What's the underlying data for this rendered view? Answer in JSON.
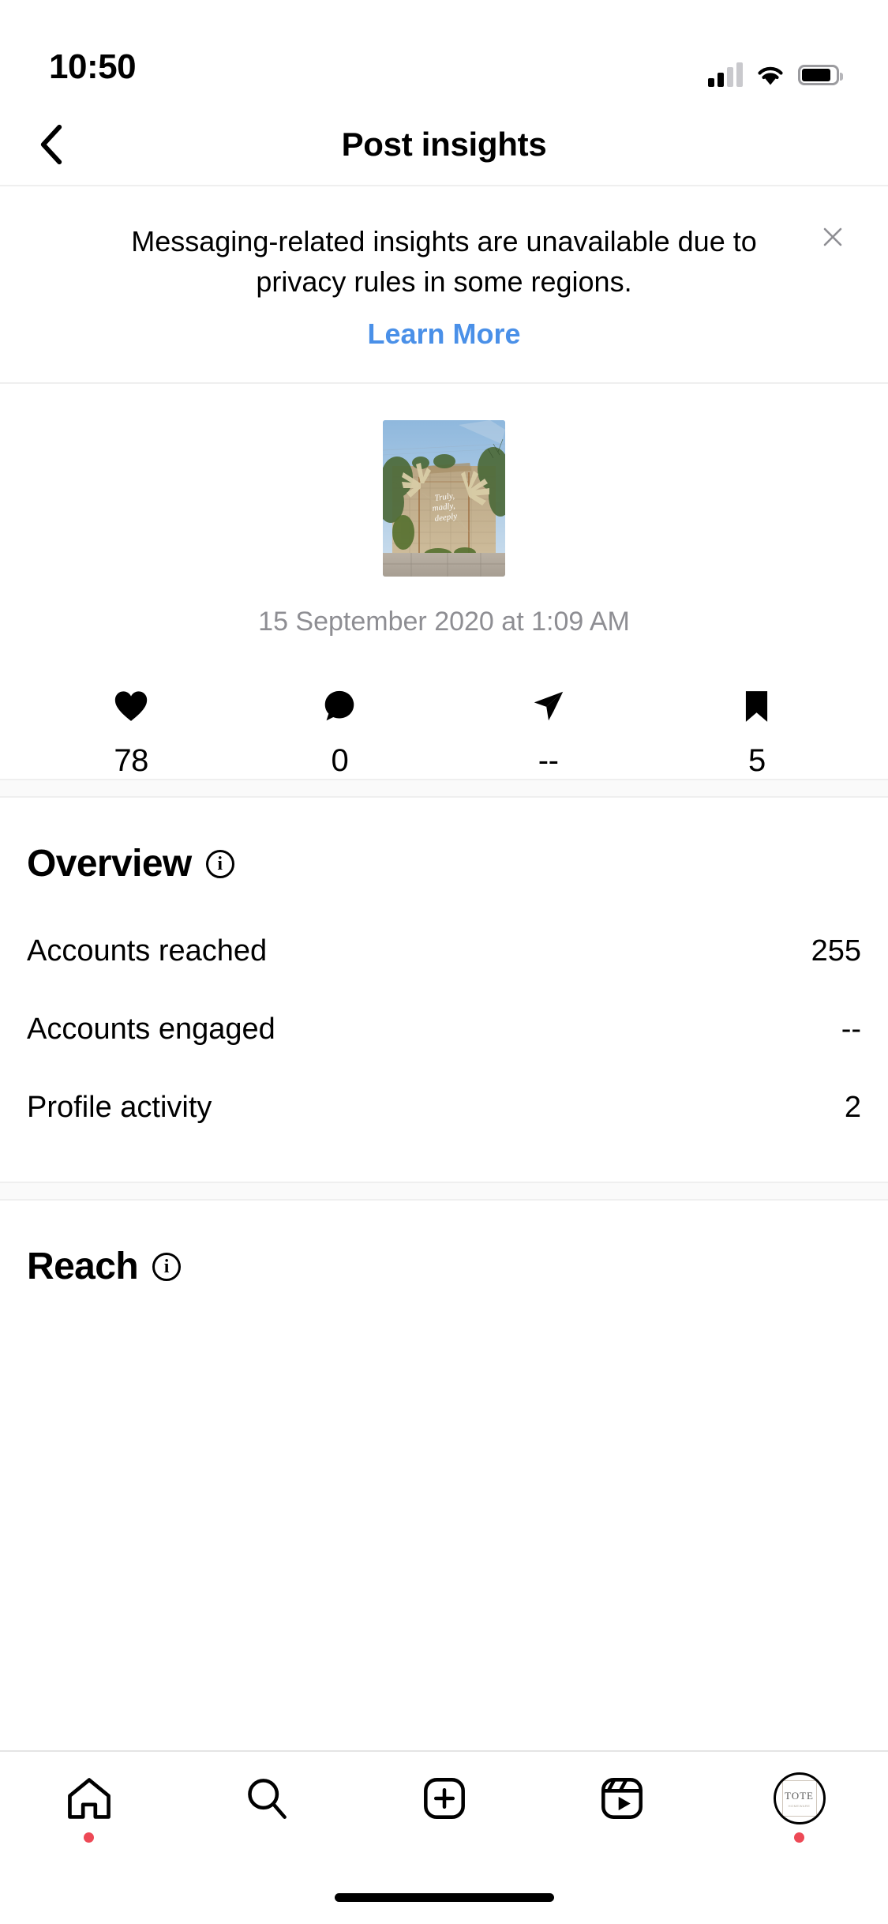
{
  "status_bar": {
    "time": "10:50",
    "cellular_icon": "signal-bars-icon",
    "wifi_icon": "wifi-icon",
    "battery_icon": "battery-icon"
  },
  "header": {
    "back_icon": "chevron-left-icon",
    "title": "Post insights"
  },
  "banner": {
    "message": "Messaging-related insights are unavailable due to privacy rules in some regions.",
    "link_label": "Learn More",
    "close_icon": "close-icon"
  },
  "post": {
    "thumbnail_alt": "post-thumbnail",
    "thumbnail_overlay_text": "Truly, madly, deeply",
    "date": "15 September 2020 at 1:09 AM",
    "stats": [
      {
        "icon": "heart-icon",
        "name": "likes",
        "value": "78"
      },
      {
        "icon": "comment-icon",
        "name": "comments",
        "value": "0"
      },
      {
        "icon": "share-icon",
        "name": "shares",
        "value": "--"
      },
      {
        "icon": "bookmark-icon",
        "name": "saves",
        "value": "5"
      }
    ]
  },
  "overview": {
    "title": "Overview",
    "info_icon": "info-icon",
    "rows": [
      {
        "label": "Accounts reached",
        "value": "255"
      },
      {
        "label": "Accounts engaged",
        "value": "--"
      },
      {
        "label": "Profile activity",
        "value": "2"
      }
    ]
  },
  "reach": {
    "title": "Reach",
    "info_icon": "info-icon"
  },
  "tabbar": {
    "items": [
      {
        "name": "tab-home",
        "icon": "home-icon",
        "badge": true
      },
      {
        "name": "tab-search",
        "icon": "search-icon",
        "badge": false
      },
      {
        "name": "tab-create",
        "icon": "plus-box-icon",
        "badge": false
      },
      {
        "name": "tab-reels",
        "icon": "reels-icon",
        "badge": false
      },
      {
        "name": "tab-profile",
        "icon": "avatar-icon",
        "badge": true,
        "avatar_word": "TOTE",
        "avatar_sub": "HOMEWARE"
      }
    ]
  },
  "colors": {
    "link": "#4a90e8",
    "badge": "#ed4956",
    "muted": "#8e8e93",
    "divider": "#efefef"
  }
}
